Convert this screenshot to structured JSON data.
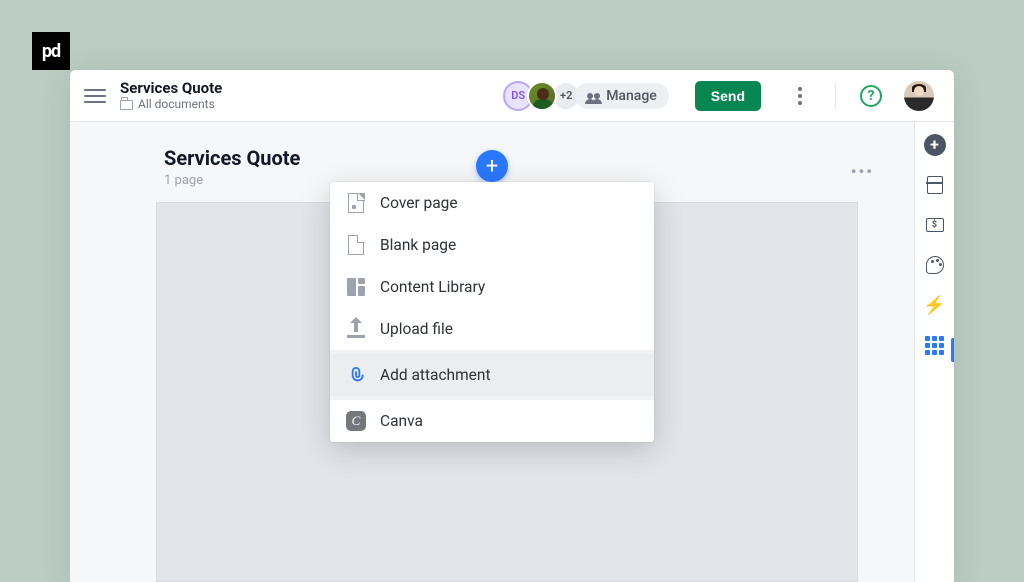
{
  "brand": {
    "badge": "pd"
  },
  "header": {
    "title": "Services Quote",
    "breadcrumb": "All documents",
    "collaborators": {
      "initials": "DS",
      "extra_count": "+2",
      "manage_label": "Manage"
    },
    "send_label": "Send",
    "help_label": "?"
  },
  "document": {
    "title": "Services Quote",
    "page_count_label": "1 page",
    "more_label": "•••"
  },
  "add_menu": {
    "cover_page": "Cover page",
    "blank_page": "Blank page",
    "content_library": "Content Library",
    "upload_file": "Upload file",
    "add_attachment": "Add attachment",
    "canva": "Canva",
    "canva_glyph": "C"
  },
  "add_button_glyph": "+",
  "right_tools_plus": "+",
  "icons": {
    "hamburger": "menu-icon",
    "folder": "folder-icon",
    "plus_circle": "plus-circle-icon",
    "panel": "panel-icon",
    "box": "content-box-icon",
    "palette": "palette-icon",
    "bolt": "bolt-icon",
    "apps": "apps-grid-icon",
    "kebab": "kebab-icon",
    "help": "help-icon",
    "box_inner": "$"
  }
}
